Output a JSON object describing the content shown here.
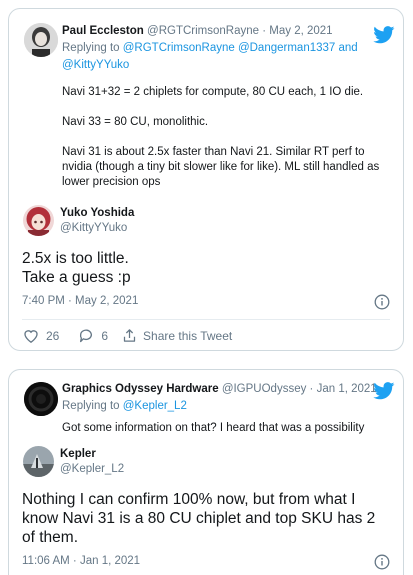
{
  "tweet1": {
    "quoted": {
      "name": "Paul Eccleston",
      "handle": "@RGTCrimsonRayne",
      "separator": "·",
      "date": "May 2, 2021",
      "replying_prefix": "Replying to",
      "replying_handles": "@RGTCrimsonRayne @Dangerman1337 and",
      "replying_handles_2": "@KittyYYuko",
      "para1": "Navi 31+32 = 2 chiplets for compute, 80 CU each, 1 IO die.",
      "para2": "Navi 33 = 80 CU, monolithic.",
      "para3_l1": "Navi 31 is about 2.5x faster than Navi 21. Similar RT perf to",
      "para3_l2": "nvidia (though a tiny bit slower like for like). ML still handled as",
      "para3_l3": "lower precision ops"
    },
    "author": {
      "name": "Yuko Yoshida",
      "handle": "@KittyYYuko"
    },
    "text_l1": "2.5x is too little.",
    "text_l2": "Take a guess :p",
    "timestamp": "7:40 PM · May 2, 2021",
    "likes": "26",
    "replies": "6",
    "share_label": "Share this Tweet"
  },
  "tweet2": {
    "quoted": {
      "name": "Graphics Odyssey Hardware",
      "handle": "@IGPUOdyssey",
      "separator": "·",
      "date": "Jan 1, 2021",
      "replying_prefix": "Replying to",
      "replying_handles": "@Kepler_L2",
      "para1": "Got some information on that? I heard that was a possibility"
    },
    "author": {
      "name": "Kepler",
      "handle": "@Kepler_L2"
    },
    "text_l1": "Nothing I can confirm 100% now, but from what I",
    "text_l2": "know Navi 31 is a 80 CU chiplet and top SKU has 2",
    "text_l3": "of them.",
    "timestamp": "11:06 AM · Jan 1, 2021"
  },
  "colors": {
    "twitter_blue": "#1da1f2",
    "link": "#1b95e0",
    "muted": "#657786",
    "border": "#cfd9de"
  },
  "icons": [
    "twitter-bird-icon",
    "info-icon",
    "heart-icon",
    "reply-bubble-icon",
    "share-icon"
  ]
}
